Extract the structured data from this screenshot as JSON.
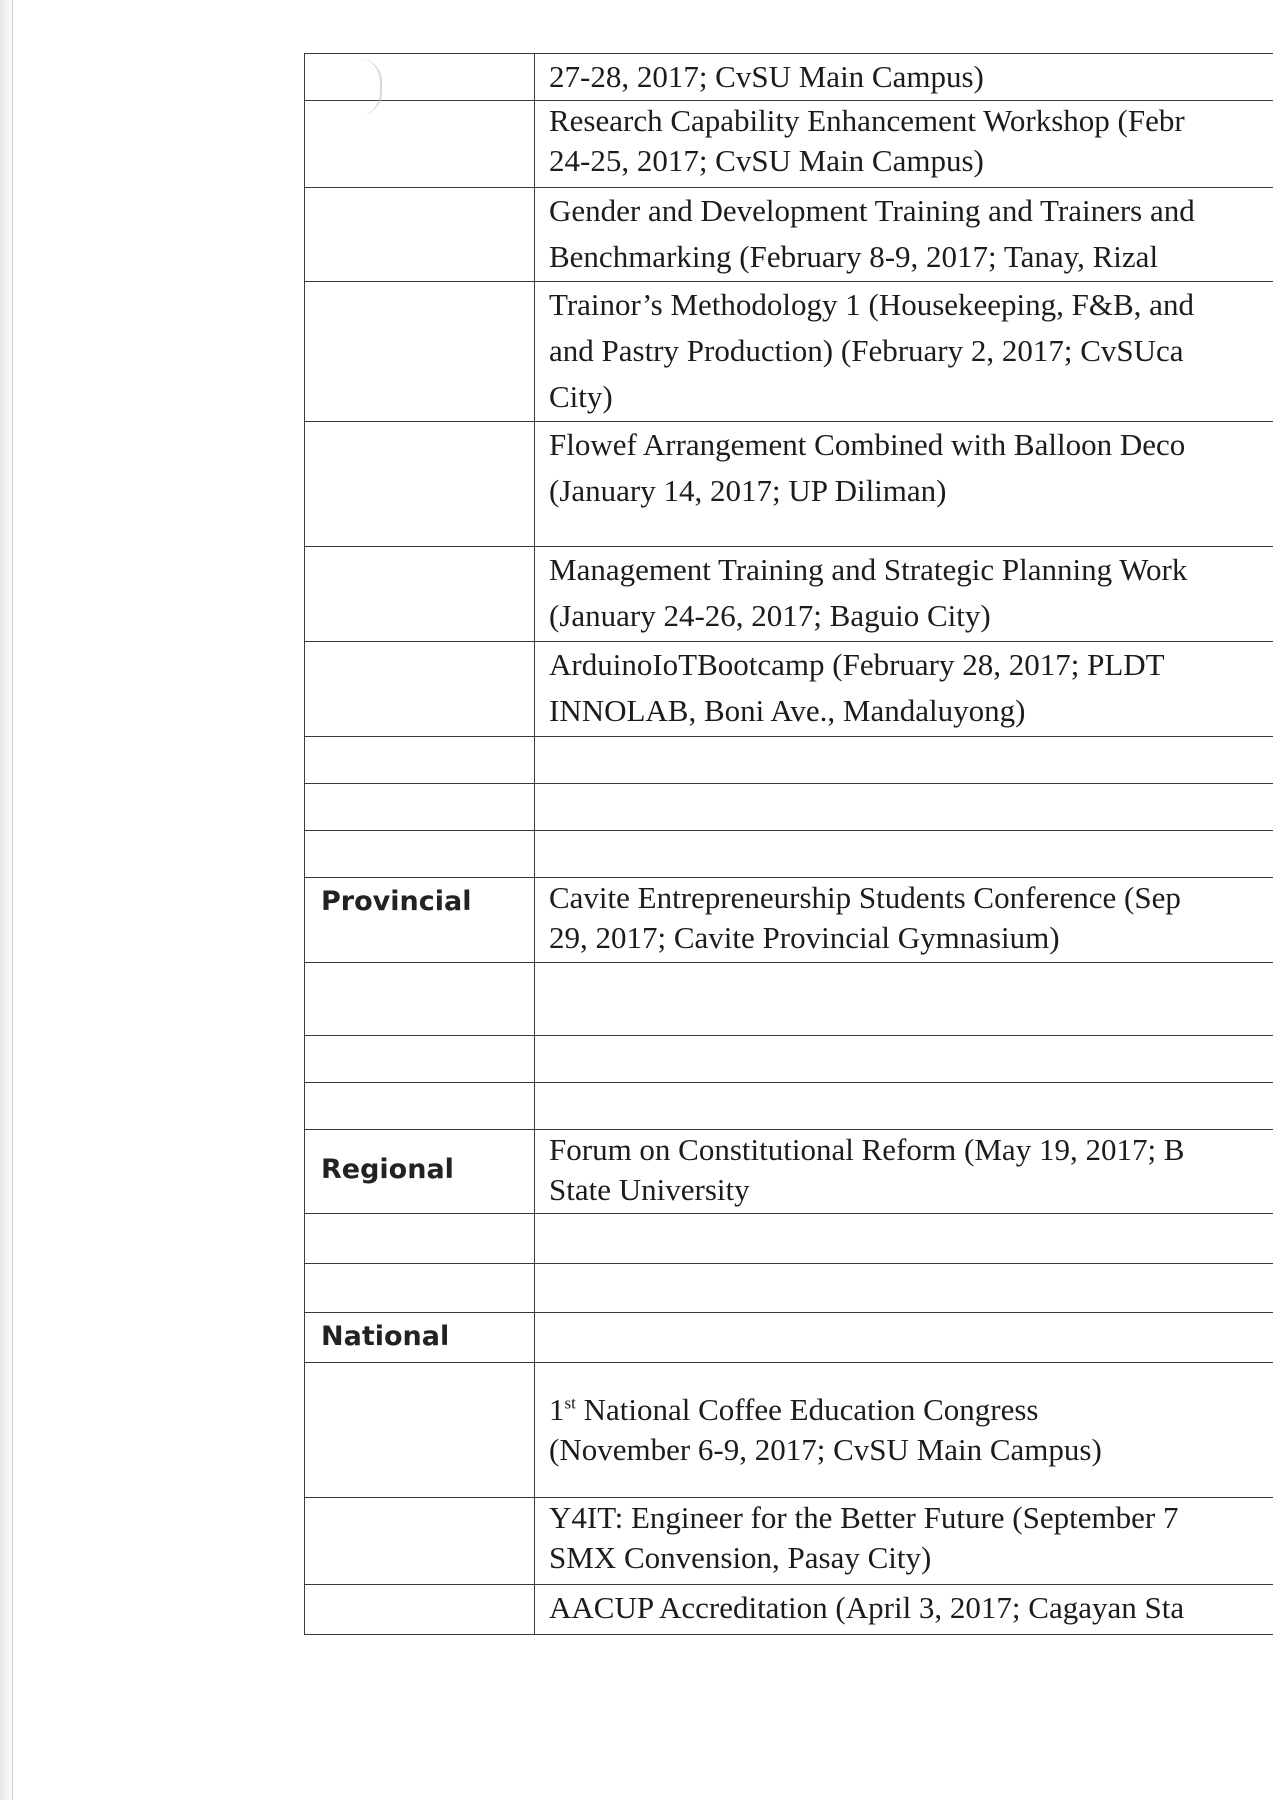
{
  "rows": [
    {
      "level": "",
      "event": "27-28, 2017; CvSU Main Campus)"
    },
    {
      "level": "",
      "event": "Research Capability Enhancement Workshop (Febr",
      "event2": "24-25, 2017; CvSU Main Campus)"
    },
    {
      "level": "",
      "event": "Gender and Development Training and Trainers and",
      "event2": "Benchmarking (February 8-9, 2017; Tanay, Rizal"
    },
    {
      "level": "",
      "event": "Trainor’s Methodology 1 (Housekeeping, F&B, and",
      "event2": "and Pastry Production) (February 2, 2017; CvSUca",
      "event3": "City)"
    },
    {
      "level": "",
      "event": "Flowef Arrangement Combined with Balloon Deco",
      "event2": "(January 14, 2017; UP Diliman)"
    },
    {
      "level": "",
      "event": "Management Training and Strategic Planning Work",
      "event2": "(January 24-26, 2017; Baguio City)"
    },
    {
      "level": "",
      "event": "ArduinoIoTBootcamp (February 28, 2017; PLDT",
      "event2": "INNOLAB, Boni Ave., Mandaluyong)"
    },
    {
      "level": "",
      "event": ""
    },
    {
      "level": "",
      "event": ""
    },
    {
      "level": "",
      "event": ""
    },
    {
      "level": "Provincial",
      "event": "Cavite Entrepreneurship Students Conference (Sep",
      "event2": "29, 2017; Cavite Provincial Gymnasium)"
    },
    {
      "level": "",
      "event": ""
    },
    {
      "level": "",
      "event": ""
    },
    {
      "level": "",
      "event": ""
    },
    {
      "level": "Regional",
      "event": "Forum on Constitutional Reform (May 19, 2017; B",
      "event2": "State University"
    },
    {
      "level": "",
      "event": ""
    },
    {
      "level": "",
      "event": ""
    },
    {
      "level": "National",
      "event": ""
    },
    {
      "level": "",
      "event_sup_num": "1",
      "event_sup": "st",
      "event": " National Coffee Education Congress",
      "event2": "(November 6-9, 2017; CvSU Main Campus)"
    },
    {
      "level": "",
      "event": "Y4IT: Engineer for the Better Future (September 7",
      "event2": "SMX Convension, Pasay City)"
    },
    {
      "level": "",
      "event": "AACUP Accreditation (April 3, 2017; Cagayan Sta"
    }
  ]
}
